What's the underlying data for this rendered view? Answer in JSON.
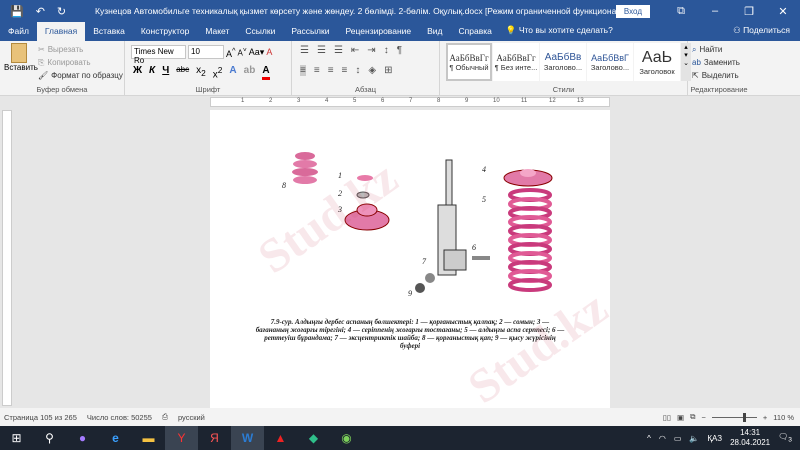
{
  "title_bar": {
    "title": "Кузнецов Автомобильге техникалық қызмет көрсету және жөндеу. 2 бөлімді. 2-бөлім. Оқулық.docx [Режим ограниченной функциональности]  -  Word",
    "login": "Вход"
  },
  "tabs": [
    "Файл",
    "Главная",
    "Вставка",
    "Конструктор",
    "Макет",
    "Ссылки",
    "Рассылки",
    "Рецензирование",
    "Вид",
    "Справка"
  ],
  "tell_me": "Что вы хотите сделать?",
  "share": "Поделиться",
  "clipboard": {
    "paste": "Вставить",
    "cut": "Вырезать",
    "copy": "Копировать",
    "format_painter": "Формат по образцу",
    "label": "Буфер обмена"
  },
  "font": {
    "name": "Times New Ro",
    "size": "10",
    "label": "Шрифт",
    "bold": "Ж",
    "italic": "К",
    "underline": "Ч"
  },
  "paragraph": {
    "label": "Абзац"
  },
  "styles": {
    "label": "Стили",
    "items": [
      {
        "sample": "АаБбВвГг",
        "name": "¶ Обычный"
      },
      {
        "sample": "АаБбВвГг",
        "name": "¶ Без инте..."
      },
      {
        "sample": "АаБбВв",
        "name": "Заголово..."
      },
      {
        "sample": "АаБбВвГ",
        "name": "Заголово..."
      },
      {
        "sample": "АаЬ",
        "name": "Заголовок"
      }
    ]
  },
  "editing": {
    "find": "Найти",
    "replace": "Заменить",
    "select": "Выделить",
    "label": "Редактирование"
  },
  "ruler_marks": [
    "1",
    "2",
    "3",
    "4",
    "5",
    "6",
    "7",
    "8",
    "9",
    "10",
    "11",
    "12",
    "13"
  ],
  "figure": {
    "labels": [
      "1",
      "2",
      "3",
      "4",
      "5",
      "6",
      "7",
      "8",
      "9"
    ],
    "caption": "7.9-сур.  Алдыңғы  дербес  аспаның бөлшектері: 1 — қорғаныстық қалпақ; 2 — сомын; 3 — бағананың жоғарғы тірегіні; 4 — серіппенің жоғарғы тостағаны; 5 — алдыңғы аспа серппесі; 6 — реттеуіш бұрандама; 7 — эксцентриктік шайба; 8 — қорғаныстық қап; 9 — қысу жүрісінің буфері"
  },
  "watermark": "Stud.kz",
  "status": {
    "page": "Страница 105 из 265",
    "words": "Число слов: 50255",
    "language": "русский",
    "zoom": "110 %",
    "zoom_percent": 110
  },
  "taskbar": {
    "lang": "ҚАЗ",
    "time": "14:31",
    "date": "28.04.2021",
    "notifications": "3"
  }
}
